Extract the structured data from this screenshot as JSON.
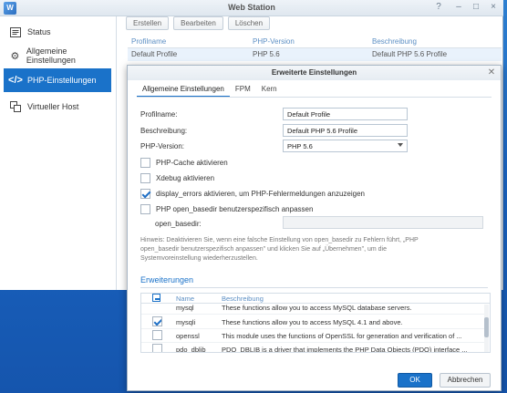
{
  "window": {
    "title": "Web Station",
    "controls": [
      "?",
      "–",
      "□",
      "×"
    ]
  },
  "sidebar": {
    "items": [
      {
        "label": "Status",
        "icon": "status-icon"
      },
      {
        "label": "Allgemeine Einstellungen",
        "icon": "gear-icon"
      },
      {
        "label": "PHP-Einstellungen",
        "icon": "code-icon",
        "active": true
      },
      {
        "label": "Virtueller Host",
        "icon": "virtual-host-icon"
      }
    ]
  },
  "toolbar": {
    "create_label": "Erstellen",
    "edit_label": "Bearbeiten",
    "delete_label": "Löschen"
  },
  "grid": {
    "columns": [
      "Profilname",
      "PHP-Version",
      "Beschreibung"
    ],
    "rows": [
      [
        "Default Profile",
        "PHP 5.6",
        "Default PHP 5.6 Profile"
      ]
    ]
  },
  "dialog": {
    "title": "Erweiterte Einstellungen",
    "tabs": [
      "Allgemeine Einstellungen",
      "FPM",
      "Kern"
    ],
    "active_tab": "Allgemeine Einstellungen",
    "fields": {
      "profile_name_label": "Profilname:",
      "profile_name_value": "Default Profile",
      "description_label": "Beschreibung:",
      "description_value": "Default PHP 5.6 Profile",
      "php_version_label": "PHP-Version:",
      "php_version_value": "PHP 5.6"
    },
    "checkboxes": [
      {
        "label": "PHP-Cache aktivieren",
        "checked": false
      },
      {
        "label": "Xdebug aktivieren",
        "checked": false
      },
      {
        "label": "display_errors aktivieren, um PHP-Fehlermeldungen anzuzeigen",
        "checked": true
      },
      {
        "label": "PHP open_basedir benutzerspezifisch anpassen",
        "checked": false
      }
    ],
    "open_basedir_label": "open_basedir:",
    "hint_lines": [
      "Hinweis: Deaktivieren Sie, wenn eine falsche Einstellung von open_basedir zu Fehlern führt, „PHP",
      "open_basedir benutzerspezifisch anpassen\" und klicken Sie auf „Übernehmen\", um die",
      "Systemvoreinstellung wiederherzustellen."
    ],
    "extensions": {
      "section_title": "Erweiterungen",
      "columns": [
        "Name",
        "Beschreibung"
      ],
      "rows": [
        {
          "name": "mysql",
          "description": "These functions allow you to access MySQL database servers.",
          "checked": false
        },
        {
          "name": "mysqli",
          "description": "These functions allow you to access MySQL 4.1 and above.",
          "checked": true
        },
        {
          "name": "openssl",
          "description": "This module uses the functions of OpenSSL for generation and verification of ...",
          "checked": false
        },
        {
          "name": "pdo_dblib",
          "description": "PDO_DBLIB is a driver that implements the PHP Data Objects (PDO) interface ...",
          "checked": false
        }
      ]
    },
    "ok_label": "OK",
    "cancel_label": "Abbrechen"
  },
  "colors": {
    "accent": "#1a72c9",
    "desktop": "#1a63c0"
  }
}
